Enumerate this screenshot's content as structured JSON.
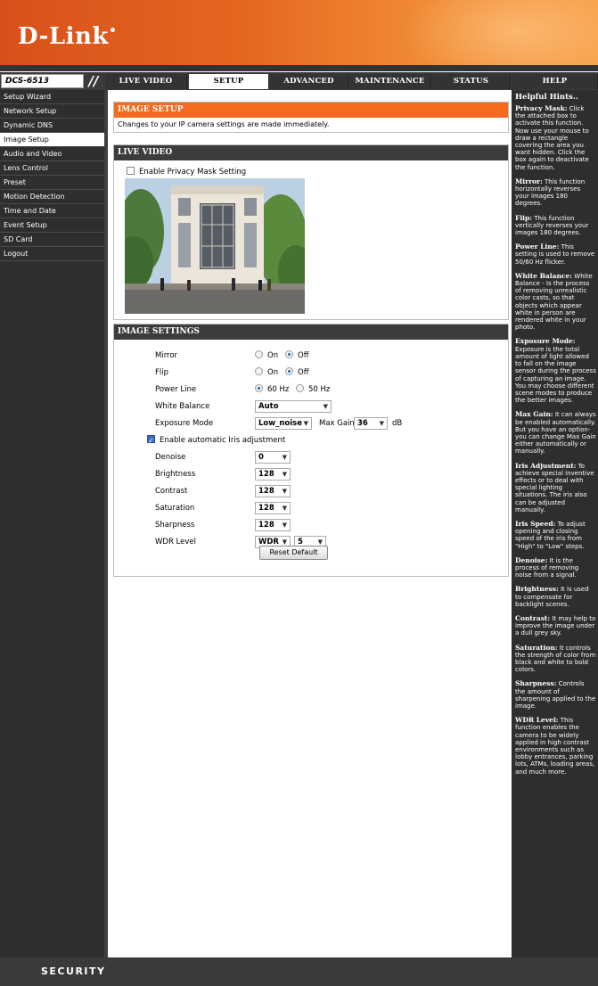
{
  "brand": {
    "logo": "D-Link",
    "footer": "SECURITY"
  },
  "model": "DCS-6513",
  "nav": {
    "tabs": [
      "LIVE VIDEO",
      "SETUP",
      "ADVANCED",
      "MAINTENANCE",
      "STATUS",
      "HELP"
    ],
    "active": "SETUP"
  },
  "sidebar": {
    "items": [
      "Setup Wizard",
      "Network Setup",
      "Dynamic DNS",
      "Image Setup",
      "Audio and Video",
      "Lens Control",
      "Preset",
      "Motion Detection",
      "Time and Date",
      "Event Setup",
      "SD Card",
      "Logout"
    ],
    "active": "Image Setup"
  },
  "image_setup": {
    "title": "IMAGE SETUP",
    "notice": "Changes to your IP camera settings are made immediately."
  },
  "live_video": {
    "title": "LIVE VIDEO",
    "privacy_label": "Enable Privacy Mask Setting",
    "privacy_checked": false
  },
  "settings": {
    "title": "IMAGE SETTINGS",
    "mirror": {
      "label": "Mirror",
      "on": "On",
      "off": "Off",
      "value": "Off"
    },
    "flip": {
      "label": "Flip",
      "on": "On",
      "off": "Off",
      "value": "Off"
    },
    "power_line": {
      "label": "Power Line",
      "opt1": "60 Hz",
      "opt2": "50 Hz",
      "value": "60 Hz"
    },
    "white_balance": {
      "label": "White Balance",
      "value": "Auto"
    },
    "exposure_mode": {
      "label": "Exposure Mode",
      "value": "Low_noise",
      "max_gain_label": "Max Gain",
      "max_gain": "36",
      "unit": "dB"
    },
    "iris": {
      "label": "Enable automatic Iris adjustment",
      "checked": true
    },
    "denoise": {
      "label": "Denoise",
      "value": "0"
    },
    "brightness": {
      "label": "Brightness",
      "value": "128"
    },
    "contrast": {
      "label": "Contrast",
      "value": "128"
    },
    "saturation": {
      "label": "Saturation",
      "value": "128"
    },
    "sharpness": {
      "label": "Sharpness",
      "value": "128"
    },
    "wdr": {
      "label": "WDR Level",
      "mode": "WDR",
      "level": "5"
    },
    "reset_label": "Reset Default"
  },
  "help": {
    "title": "Helpful Hints..",
    "hints": [
      {
        "term": "Privacy Mask:",
        "text": " Click the attached box to activate this function. Now use your mouse to draw a rectangle covering the area you want hidden. Click the box again to deactivate the function."
      },
      {
        "term": "Mirror:",
        "text": " This function horizontally reverses your images 180 degrees."
      },
      {
        "term": "Flip:",
        "text": " This function vertically reverses your images 180 degrees."
      },
      {
        "term": "Power Line:",
        "text": " This setting is used to remove 50/60 Hz flicker."
      },
      {
        "term": "White Balance:",
        "text": " White Balance - Is the process of removing unrealistic color casts, so that objects which appear white in person are rendered white in your photo."
      },
      {
        "term": "Exposure Mode:",
        "text": " Exposure is the total amount of light allowed to fall on the image sensor during the process of capturing an image. You may choose different scene modes to produce the better images."
      },
      {
        "term": "Max Gain:",
        "text": " It can always be enabled automatically. But you have an option-you can change Max Gain either automatically or manually."
      },
      {
        "term": "Iris Adjustment:",
        "text": " To achieve special inventive effects or to deal with special lighting situations. The iris also can be adjusted manually."
      },
      {
        "term": "Iris Speed:",
        "text": " To adjust opening and closing speed of the iris from \"High\" to \"Low\" steps."
      },
      {
        "term": "Denoise:",
        "text": " It is the process of removing noise from a signal."
      },
      {
        "term": "Brightness:",
        "text": " It is used to compensate for backlight scenes."
      },
      {
        "term": "Contrast:",
        "text": " It may help to improve the image under a dull grey sky."
      },
      {
        "term": "Saturation:",
        "text": " It controls the strength of color from black and white to bold colors."
      },
      {
        "term": "Sharpness:",
        "text": " Controls the amount of sharpening applied to the image."
      },
      {
        "term": "WDR Level:",
        "text": " This function enables the camera to be widely applied in high contrast environments such as lobby entrances, parking lots, ATMs, loading areas, and much more."
      }
    ]
  },
  "colors": {
    "accent": "#f26b1e",
    "dark": "#2e2e2e",
    "header": "#e5661f"
  }
}
